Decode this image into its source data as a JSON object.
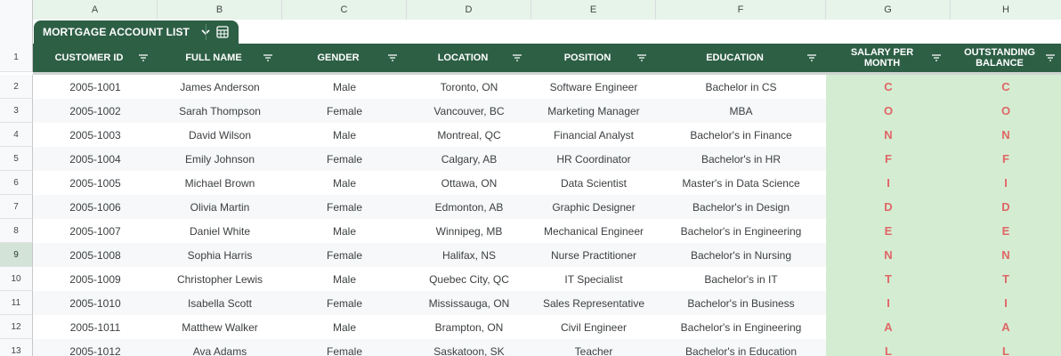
{
  "columns": {
    "letters": [
      "A",
      "B",
      "C",
      "D",
      "E",
      "F",
      "G",
      "H"
    ]
  },
  "table": {
    "name": "MORTGAGE ACCOUNT LIST",
    "chevron_icon": "chevron-down-icon",
    "calc_icon": "table-calculator-icon",
    "header_row_number": "1",
    "headers": [
      "CUSTOMER ID",
      "FULL NAME",
      "GENDER",
      "LOCATION",
      "POSITION",
      "EDUCATION",
      "SALARY PER MONTH",
      "OUTSTANDING BALANCE"
    ]
  },
  "rows": [
    {
      "num": "2",
      "cells": [
        "2005-1001",
        "James Anderson",
        "Male",
        "Toronto, ON",
        "Software Engineer",
        "Bachelor in CS",
        "C",
        "C"
      ]
    },
    {
      "num": "3",
      "cells": [
        "2005-1002",
        "Sarah Thompson",
        "Female",
        "Vancouver, BC",
        "Marketing Manager",
        "MBA",
        "O",
        "O"
      ]
    },
    {
      "num": "4",
      "cells": [
        "2005-1003",
        "David Wilson",
        "Male",
        "Montreal, QC",
        "Financial Analyst",
        "Bachelor's in Finance",
        "N",
        "N"
      ]
    },
    {
      "num": "5",
      "cells": [
        "2005-1004",
        "Emily Johnson",
        "Female",
        "Calgary, AB",
        "HR Coordinator",
        "Bachelor's in HR",
        "F",
        "F"
      ]
    },
    {
      "num": "6",
      "cells": [
        "2005-1005",
        "Michael Brown",
        "Male",
        "Ottawa, ON",
        "Data Scientist",
        "Master's in Data Science",
        "I",
        "I"
      ]
    },
    {
      "num": "7",
      "cells": [
        "2005-1006",
        "Olivia Martin",
        "Female",
        "Edmonton, AB",
        "Graphic Designer",
        "Bachelor's in Design",
        "D",
        "D"
      ]
    },
    {
      "num": "8",
      "cells": [
        "2005-1007",
        "Daniel White",
        "Male",
        "Winnipeg, MB",
        "Mechanical Engineer",
        "Bachelor's in Engineering",
        "E",
        "E"
      ]
    },
    {
      "num": "9",
      "cells": [
        "2005-1008",
        "Sophia Harris",
        "Female",
        "Halifax, NS",
        "Nurse Practitioner",
        "Bachelor's in Nursing",
        "N",
        "N"
      ]
    },
    {
      "num": "10",
      "cells": [
        "2005-1009",
        "Christopher Lewis",
        "Male",
        "Quebec City, QC",
        "IT Specialist",
        "Bachelor's in IT",
        "T",
        "T"
      ]
    },
    {
      "num": "11",
      "cells": [
        "2005-1010",
        "Isabella Scott",
        "Female",
        "Mississauga, ON",
        "Sales Representative",
        "Bachelor's in Business",
        "I",
        "I"
      ]
    },
    {
      "num": "12",
      "cells": [
        "2005-1011",
        "Matthew Walker",
        "Male",
        "Brampton, ON",
        "Civil Engineer",
        "Bachelor's in Engineering",
        "A",
        "A"
      ]
    },
    {
      "num": "13",
      "cells": [
        "2005-1012",
        "Ava Adams",
        "Female",
        "Saskatoon, SK",
        "Teacher",
        "Bachelor's in Education",
        "L",
        "L"
      ]
    }
  ],
  "colors": {
    "header_bg": "#2d5f45",
    "confidential_bg": "#d4ecd2",
    "confidential_text": "#e06666",
    "selected_row_bg": "#d3e3d7"
  },
  "selected_row": "9"
}
